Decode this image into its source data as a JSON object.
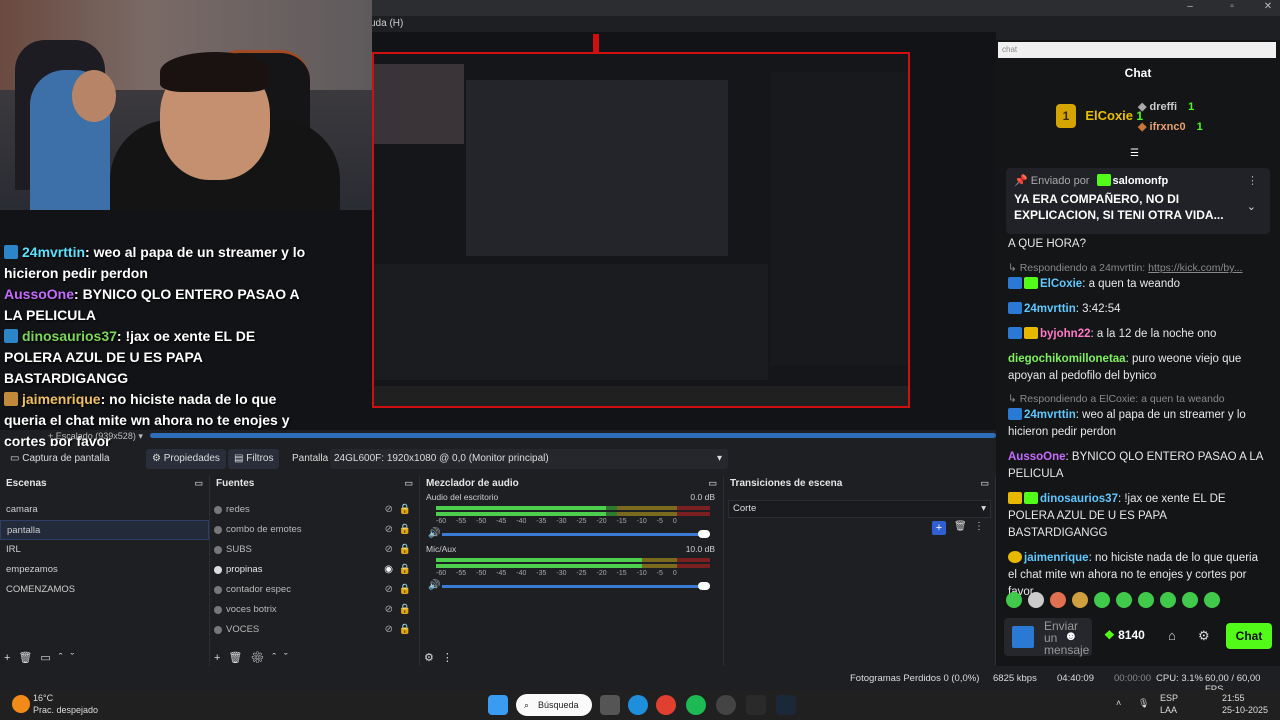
{
  "menubar": {
    "help_fragment": "uda (H)"
  },
  "overlay_chat": [
    {
      "user": "24mvrttin",
      "text": ": weo al papa de un streamer y lo hicieron pedir perdon",
      "color": "blue"
    },
    {
      "user": "AussoOne",
      "text": ": BYNICO QLO ENTERO PASAO A LA PELICULA",
      "color": "purple"
    },
    {
      "user": "dinosaurios37",
      "text": ": !jax oe xente EL DE POLERA AZUL DE U ES PAPA BASTARDIGANGG",
      "color": "green"
    },
    {
      "user": "jaimenrique",
      "text": ": no hiciste nada de lo que queria el chat mite wn ahora no te enojes y cortes por favor",
      "color": "orange"
    }
  ],
  "preview": {
    "scale_label": "Escalado (939x528)"
  },
  "source_toolbar": {
    "source_name": "Captura de pantalla",
    "properties_label": "Propiedades",
    "filters_label": "Filtros",
    "display_label": "Pantalla",
    "monitor_value": "24GL600F: 1920x1080 @ 0,0 (Monitor principal)"
  },
  "scenes": {
    "title": "Escenas",
    "items": [
      "camara",
      "pantalla",
      "IRL",
      "empezamos",
      "COMENZAMOS"
    ],
    "selected": "pantalla"
  },
  "sources": {
    "title": "Fuentes",
    "items": [
      "redes",
      "combo de emotes",
      "SUBS",
      "propinas",
      "contador espec",
      "voces botrix",
      "VOCES"
    ]
  },
  "mixer": {
    "title": "Mezclador de audio",
    "channels": [
      {
        "name": "Audio del escritorio",
        "db": "0.0 dB",
        "level": 0.62,
        "volume": 1.0
      },
      {
        "name": "Mic/Aux",
        "db": "10.0 dB",
        "level": 0.75,
        "volume": 1.0
      }
    ],
    "scale": "-60 -55 -50 -45 -40 -35 -30 -25 -20 -15 -10 -5 0"
  },
  "transitions": {
    "title": "Transiciones de escena",
    "selected": "Corte"
  },
  "statusbar": {
    "dropped_frames": "Fotogramas Perdidos 0 (0,0%)",
    "bitrate": "6825 kbps",
    "live_time": "04:40:09",
    "rec_time": "00:00:00",
    "cpu": "CPU: 3.1%",
    "fps": "60,00 / 60,00 FPS"
  },
  "taskbar": {
    "weather_temp": "16°C",
    "weather_desc": "Prac. despejado",
    "search_label": "Búsqueda",
    "lang_top": "ESP",
    "lang_bottom": "LAA",
    "time": "21:55",
    "date": "25-10-2025"
  },
  "chat": {
    "search_placeholder": "chat",
    "title": "Chat",
    "leaderboard": [
      {
        "rank": "1",
        "name": "ElCoxie",
        "count": "1"
      },
      {
        "name": "dreffi",
        "count": "1"
      },
      {
        "name": "ifrxnc0",
        "count": "1"
      }
    ],
    "pinned": {
      "label": "Enviado por",
      "user": "salomonfp",
      "text": "YA ERA COMPAÑERO, NO DI EXPLICACION, SI TENI OTRA VIDA...",
      "continuation": "A QUE HORA?"
    },
    "messages": [
      {
        "reply": "Respondiendo a 24mvrttin:",
        "reply_link": "https://kick.com/by...",
        "user": "ElCoxie",
        "text": ": a quen ta weando",
        "color": "blue"
      },
      {
        "user": "24mvrttin",
        "text": ": 3:42:54",
        "color": "blue"
      },
      {
        "user": "byjohn22",
        "text": ": a la 12 de la noche ono",
        "color": "pink"
      },
      {
        "user": "diegochikomillonetaa",
        "text": ": puro weone viejo que apoyan al pedofilo del bynico",
        "color": "green"
      },
      {
        "reply": "Respondiendo a ElCoxie: a quen ta weando",
        "user": "24mvrttin",
        "text": ": weo al papa de un streamer y lo hicieron pedir perdon",
        "color": "blue"
      },
      {
        "user": "AussoOne",
        "text": ": BYNICO QLO ENTERO PASAO A LA PELICULA",
        "color": "purple"
      },
      {
        "user": "dinosaurios37",
        "text": ": !jax oe xente EL DE POLERA AZUL DE U ES PAPA BASTARDIGANGG",
        "color": "blue"
      },
      {
        "user": "jaimenrique",
        "text": ": no hiciste nada de lo que queria el chat mite wn ahora no te enojes y cortes por favor",
        "color": "blue"
      }
    ],
    "input_placeholder": "Enviar un mensaje",
    "points": "8140",
    "send_label": "Chat"
  }
}
